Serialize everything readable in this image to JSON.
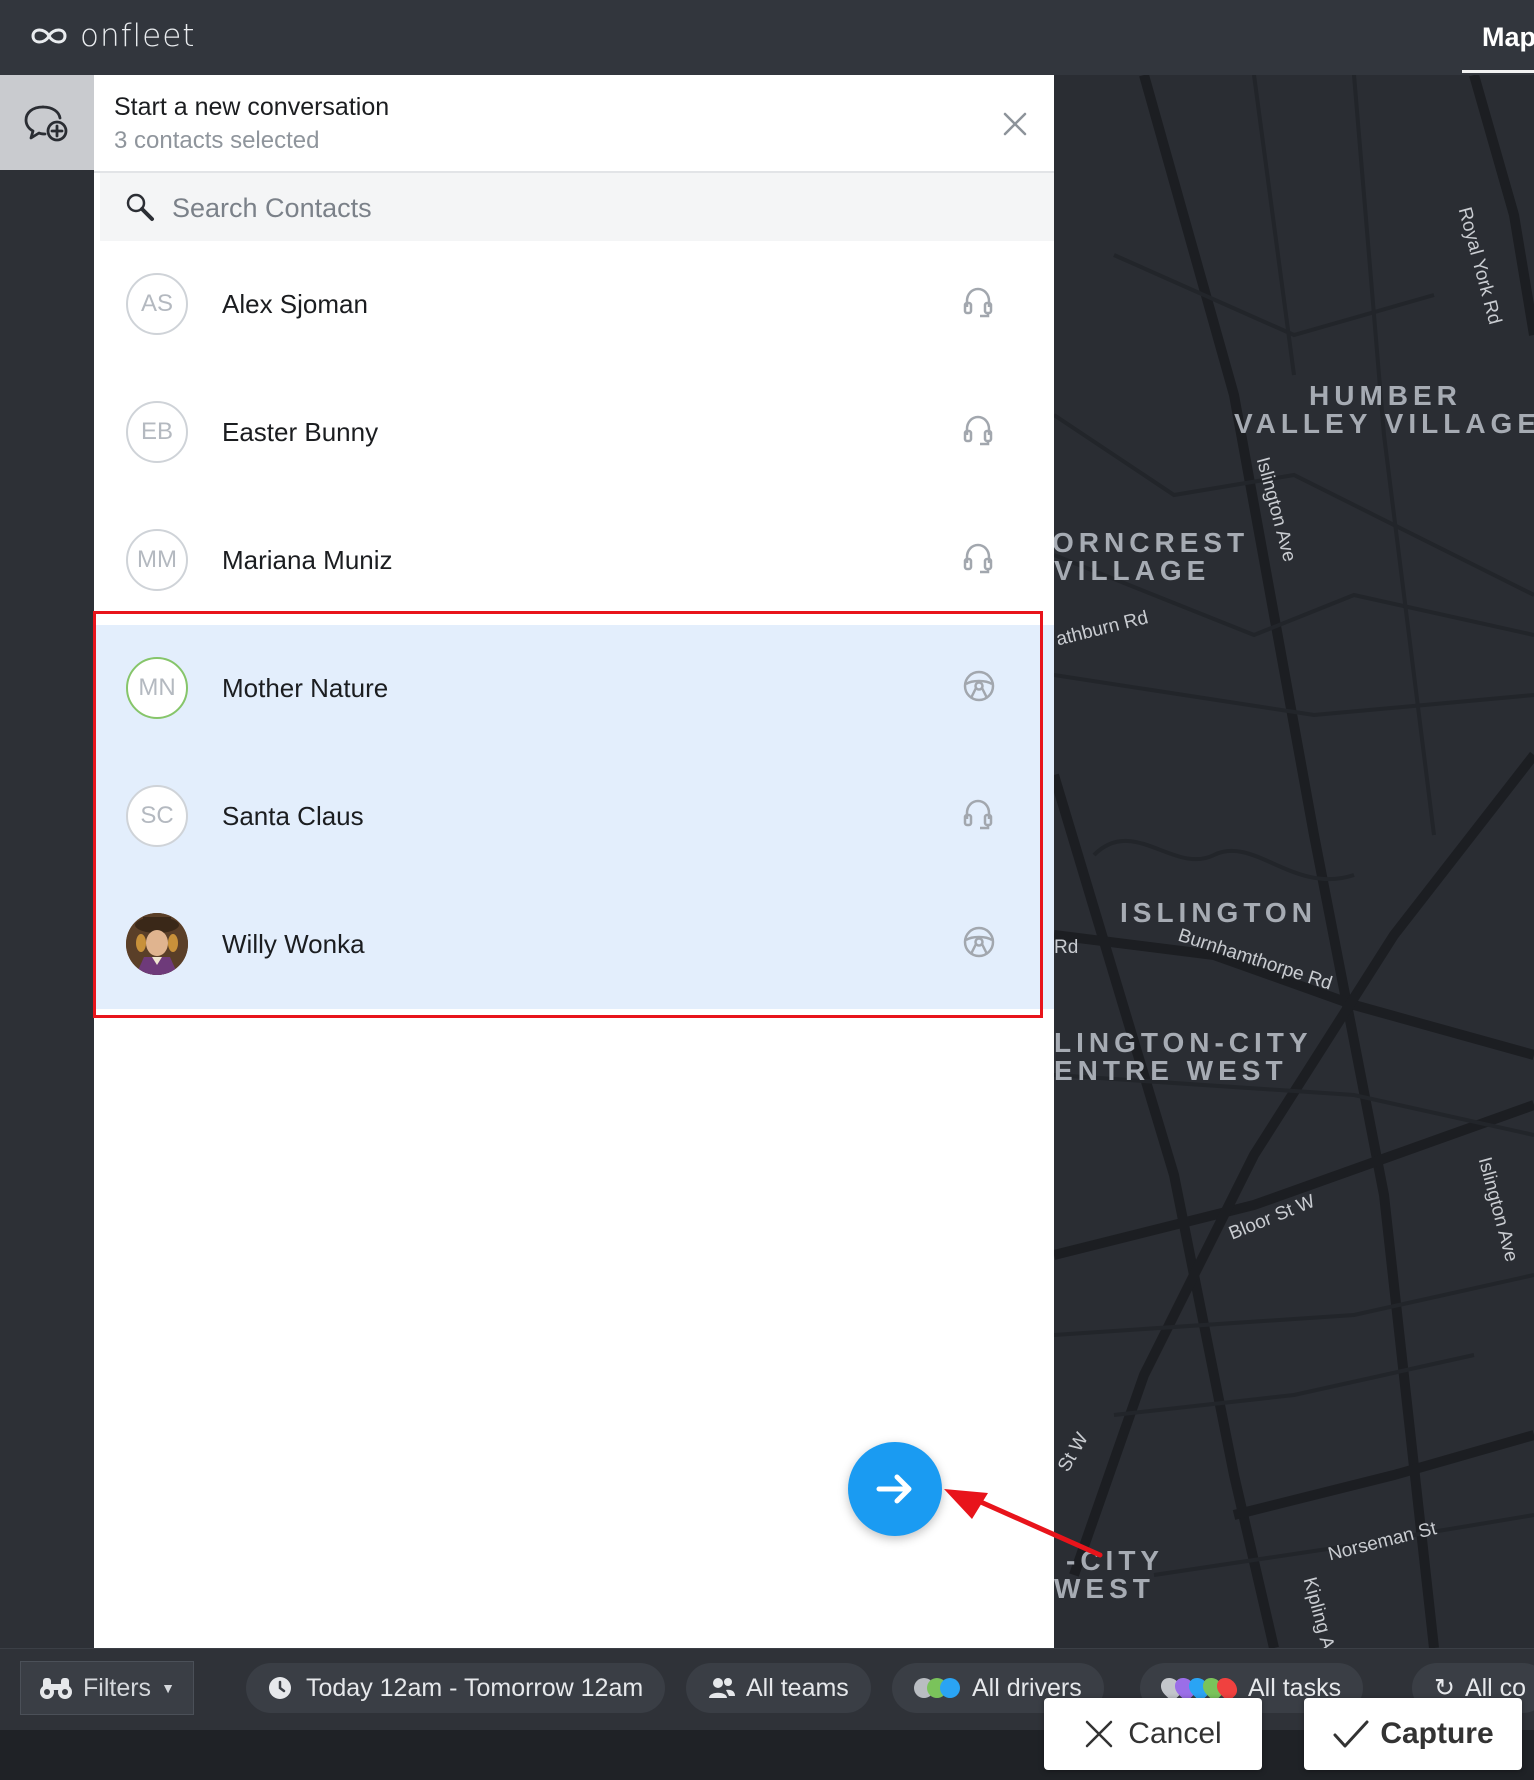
{
  "app": {
    "logo_text": "onfleet",
    "map_tab": "Map"
  },
  "panel": {
    "title": "Start a new conversation",
    "subtitle": "3 contacts selected",
    "search_placeholder": "Search Contacts"
  },
  "contacts": [
    {
      "initials": "AS",
      "name": "Alex Sjoman",
      "role_icon": "headset-icon",
      "selected": false
    },
    {
      "initials": "EB",
      "name": "Easter Bunny",
      "role_icon": "headset-icon",
      "selected": false
    },
    {
      "initials": "MM",
      "name": "Mariana Muniz",
      "role_icon": "headset-icon",
      "selected": false
    },
    {
      "initials": "MN",
      "name": "Mother Nature",
      "role_icon": "steering-wheel-icon",
      "selected": true
    },
    {
      "initials": "SC",
      "name": "Santa Claus",
      "role_icon": "headset-icon",
      "selected": true
    },
    {
      "initials": "",
      "name": "Willy Wonka",
      "role_icon": "steering-wheel-icon",
      "selected": true
    }
  ],
  "map": {
    "areas": [
      "HUMBER",
      "VALLEY VILLAGE",
      "ORNCREST",
      "VILLAGE",
      "ISLINGTON",
      "LINGTON-CITY",
      "ENTRE WEST",
      "-CITY",
      "WEST"
    ],
    "streets": [
      "Royal York Rd",
      "Islington Ave",
      "athburn Rd",
      "Burnhamthorpe Rd",
      "Rd",
      "Bloor St W",
      "Islington Ave",
      "St W",
      "Norseman St",
      "Kipling A"
    ]
  },
  "bottom": {
    "filters": "Filters",
    "date_range": "Today 12am - Tomorrow 12am",
    "teams": "All teams",
    "drivers": "All drivers",
    "tasks": "All tasks",
    "other": "All co"
  },
  "capture": {
    "cancel": "Cancel",
    "capture": "Capture"
  },
  "colors": {
    "accent": "#1a9bf2",
    "highlight": "#e8141b",
    "selected_row": "#e3eefc"
  }
}
